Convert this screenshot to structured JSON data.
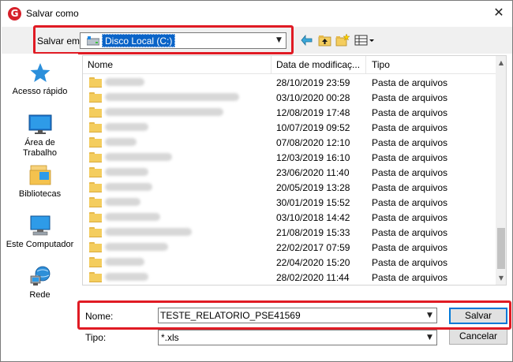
{
  "window": {
    "title": "Salvar como",
    "app_icon_letter": "G",
    "close_glyph": "✕"
  },
  "toolbar": {
    "save_in_label": "Salvar em:",
    "location_value": "Disco Local (C:)",
    "icons": [
      "back-arrow-icon",
      "up-folder-icon",
      "new-folder-icon",
      "view-menu-icon"
    ]
  },
  "places": [
    {
      "label": "Acesso rápido",
      "icon": "star-icon"
    },
    {
      "label": "Área de Trabalho",
      "icon": "desktop-icon"
    },
    {
      "label": "Bibliotecas",
      "icon": "libraries-icon"
    },
    {
      "label": "Este Computador",
      "icon": "computer-icon"
    },
    {
      "label": "Rede",
      "icon": "network-icon"
    }
  ],
  "file_list": {
    "columns": {
      "name": "Nome",
      "date": "Data de modificaç...",
      "type": "Tipo"
    },
    "rows": [
      {
        "date": "28/10/2019 23:59",
        "type": "Pasta de arquivos"
      },
      {
        "date": "03/10/2020 00:28",
        "type": "Pasta de arquivos"
      },
      {
        "date": "12/08/2019 17:48",
        "type": "Pasta de arquivos"
      },
      {
        "date": "10/07/2019 09:52",
        "type": "Pasta de arquivos"
      },
      {
        "date": "07/08/2020 12:10",
        "type": "Pasta de arquivos"
      },
      {
        "date": "12/03/2019 16:10",
        "type": "Pasta de arquivos"
      },
      {
        "date": "23/06/2020 11:40",
        "type": "Pasta de arquivos"
      },
      {
        "date": "20/05/2019 13:28",
        "type": "Pasta de arquivos"
      },
      {
        "date": "30/01/2019 15:52",
        "type": "Pasta de arquivos"
      },
      {
        "date": "03/10/2018 14:42",
        "type": "Pasta de arquivos"
      },
      {
        "date": "21/08/2019 15:33",
        "type": "Pasta de arquivos"
      },
      {
        "date": "22/02/2017 07:59",
        "type": "Pasta de arquivos"
      },
      {
        "date": "22/04/2020 15:20",
        "type": "Pasta de arquivos"
      },
      {
        "date": "28/02/2020 11:44",
        "type": "Pasta de arquivos"
      }
    ]
  },
  "bottom": {
    "name_label": "Nome:",
    "name_value": "TESTE_RELATORIO_PSE41569",
    "type_label": "Tipo:",
    "type_value": "*.xls",
    "save_button": "Salvar",
    "cancel_button": "Cancelar"
  },
  "colors": {
    "highlight_box": "#e01b24",
    "selection": "#0a64c8",
    "folder": "#f4cd5e"
  }
}
